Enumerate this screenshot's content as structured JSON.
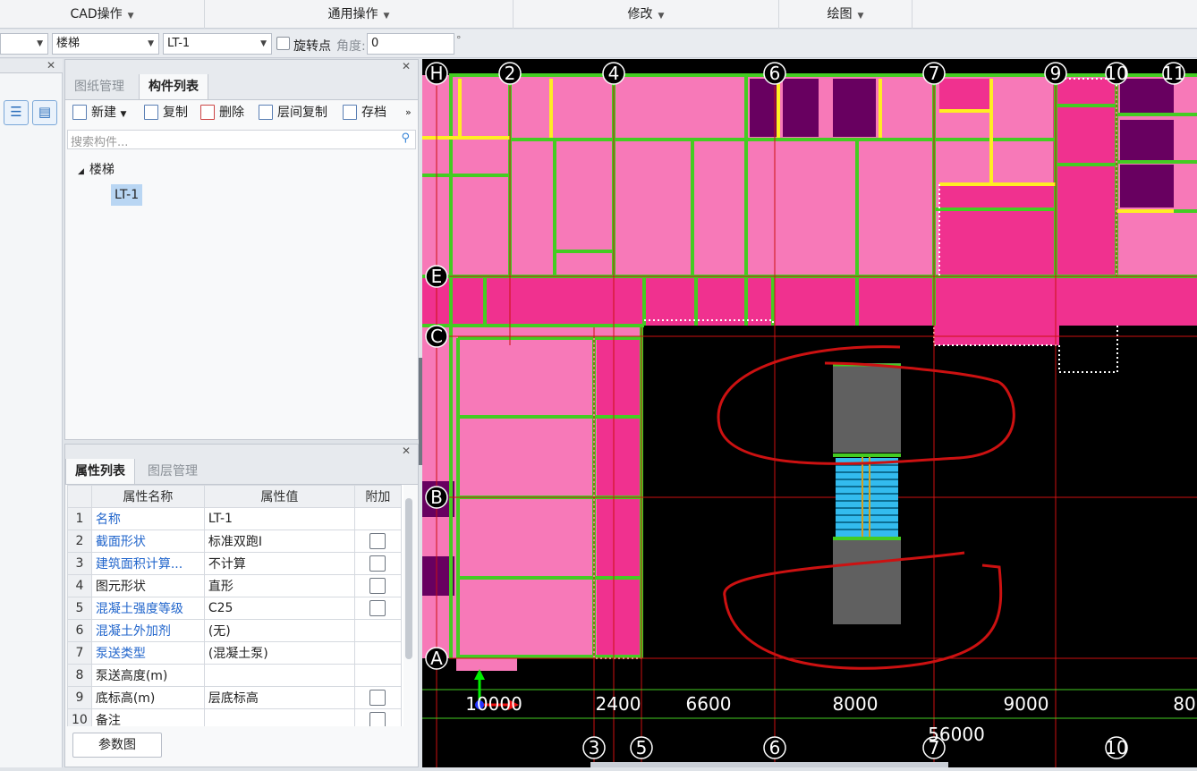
{
  "menu": {
    "items": [
      {
        "label": "CAD操作"
      },
      {
        "label": "通用操作"
      },
      {
        "label": "修改"
      },
      {
        "label": "绘图"
      }
    ]
  },
  "toolbar": {
    "type_value": "楼梯",
    "name_value": "LT-1",
    "rotate_label": "旋转点",
    "angle_label": "角度:",
    "angle_value": "0",
    "degree_symbol": "°"
  },
  "component_panel": {
    "tabs": [
      {
        "label": "图纸管理"
      },
      {
        "label": "构件列表"
      }
    ],
    "active_tab": "构件列表",
    "actions": [
      {
        "label": "新建",
        "icon": "new-icon"
      },
      {
        "label": "复制",
        "icon": "copy-icon"
      },
      {
        "label": "删除",
        "icon": "delete-icon"
      },
      {
        "label": "层间复制",
        "icon": "floor-copy-icon"
      },
      {
        "label": "存档",
        "icon": "archive-icon"
      }
    ],
    "search_placeholder": "搜索构件...",
    "tree": {
      "group": "楼梯",
      "items": [
        {
          "label": "LT-1",
          "selected": true
        }
      ]
    }
  },
  "property_panel": {
    "tabs": [
      {
        "label": "属性列表"
      },
      {
        "label": "图层管理"
      }
    ],
    "columns": [
      "属性名称",
      "属性值",
      "附加"
    ],
    "rows": [
      {
        "num": "1",
        "name": "名称",
        "value": "LT-1",
        "blue": true,
        "check": false
      },
      {
        "num": "2",
        "name": "截面形状",
        "value": "标准双跑I",
        "blue": true,
        "check": true
      },
      {
        "num": "3",
        "name": "建筑面积计算...",
        "value": "不计算",
        "blue": true,
        "check": true
      },
      {
        "num": "4",
        "name": "图元形状",
        "value": "直形",
        "blue": false,
        "check": true
      },
      {
        "num": "5",
        "name": "混凝土强度等级",
        "value": "C25",
        "blue": true,
        "check": true
      },
      {
        "num": "6",
        "name": "混凝土外加剂",
        "value": "(无)",
        "blue": true,
        "check": false
      },
      {
        "num": "7",
        "name": "泵送类型",
        "value": "(混凝土泵)",
        "blue": true,
        "check": false
      },
      {
        "num": "8",
        "name": "泵送高度(m)",
        "value": "",
        "blue": false,
        "check": false
      },
      {
        "num": "9",
        "name": "底标高(m)",
        "value": "层底标高",
        "blue": false,
        "check": true
      },
      {
        "num": "10",
        "name": "备注",
        "value": "",
        "blue": false,
        "check": true
      }
    ],
    "param_button": "参数图"
  },
  "canvas": {
    "top_axes": [
      "H",
      "2",
      "4",
      "6",
      "7",
      "9",
      "10",
      "11"
    ],
    "left_axes": [
      "E",
      "C",
      "B",
      "A"
    ],
    "bottom_axes": [
      "3",
      "5",
      "6",
      "7",
      "10"
    ],
    "dimensions": [
      "10000",
      "2400",
      "6600",
      "8000",
      "9000",
      "80",
      "56000"
    ],
    "colors": {
      "room_pink": "#f779b8",
      "slab_magenta": "#f0318f",
      "dark_purple": "#680060",
      "wall_green": "#44cc22",
      "beam_yellow": "#ffee22",
      "grid_red": "#cc1111",
      "stair_gray": "#606060",
      "stair_cyan": "#33bbee"
    }
  }
}
